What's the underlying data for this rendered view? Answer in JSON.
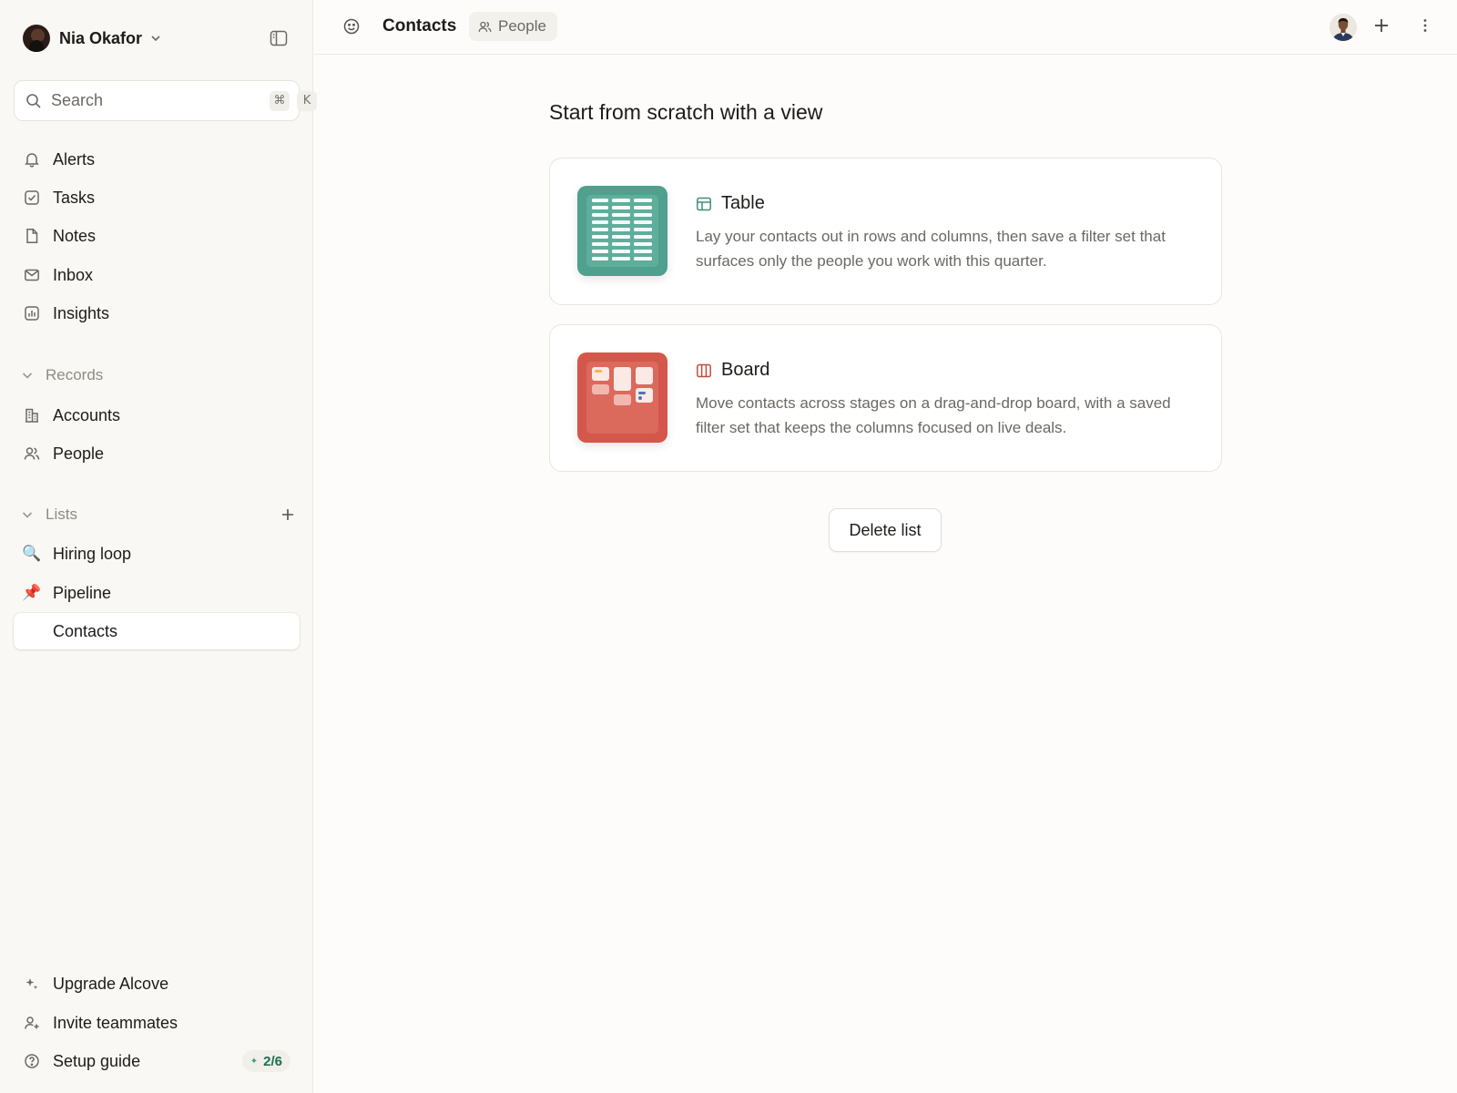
{
  "workspace": {
    "user_name": "Nia Okafor"
  },
  "search": {
    "placeholder": "Search",
    "shortcut_mod": "⌘",
    "shortcut_key": "K"
  },
  "nav": {
    "items": [
      {
        "label": "Alerts",
        "icon": "bell-icon"
      },
      {
        "label": "Tasks",
        "icon": "checkbox-icon"
      },
      {
        "label": "Notes",
        "icon": "document-icon"
      },
      {
        "label": "Inbox",
        "icon": "mail-icon"
      },
      {
        "label": "Insights",
        "icon": "chart-icon"
      }
    ]
  },
  "records": {
    "label": "Records",
    "items": [
      {
        "label": "Accounts",
        "icon": "building-icon"
      },
      {
        "label": "People",
        "icon": "people-icon"
      }
    ]
  },
  "lists": {
    "label": "Lists",
    "items": [
      {
        "label": "Hiring loop",
        "emoji": "🔍"
      },
      {
        "label": "Pipeline",
        "emoji": "📌"
      },
      {
        "label": "Contacts",
        "emoji": ""
      }
    ],
    "active_index": 2
  },
  "footer": {
    "upgrade_label": "Upgrade Alcove",
    "invite_label": "Invite teammates",
    "setup_label": "Setup guide",
    "setup_progress": "2/6"
  },
  "header": {
    "title": "Contacts",
    "chip_label": "People"
  },
  "main": {
    "heading": "Start from scratch with a view",
    "cards": [
      {
        "title": "Table",
        "description": "Lay your contacts out in rows and columns, then save a filter set that surfaces only the people you work with this quarter.",
        "accent": "#4fa08d"
      },
      {
        "title": "Board",
        "description": "Move contacts across stages on a drag-and-drop board, with a saved filter set that keeps the columns focused on live deals.",
        "accent": "#d3574a"
      }
    ],
    "delete_label": "Delete list"
  },
  "colors": {
    "sidebar_bg": "#faf8f4",
    "main_bg": "#fdfcfa",
    "badge_text": "#1f6e55"
  }
}
